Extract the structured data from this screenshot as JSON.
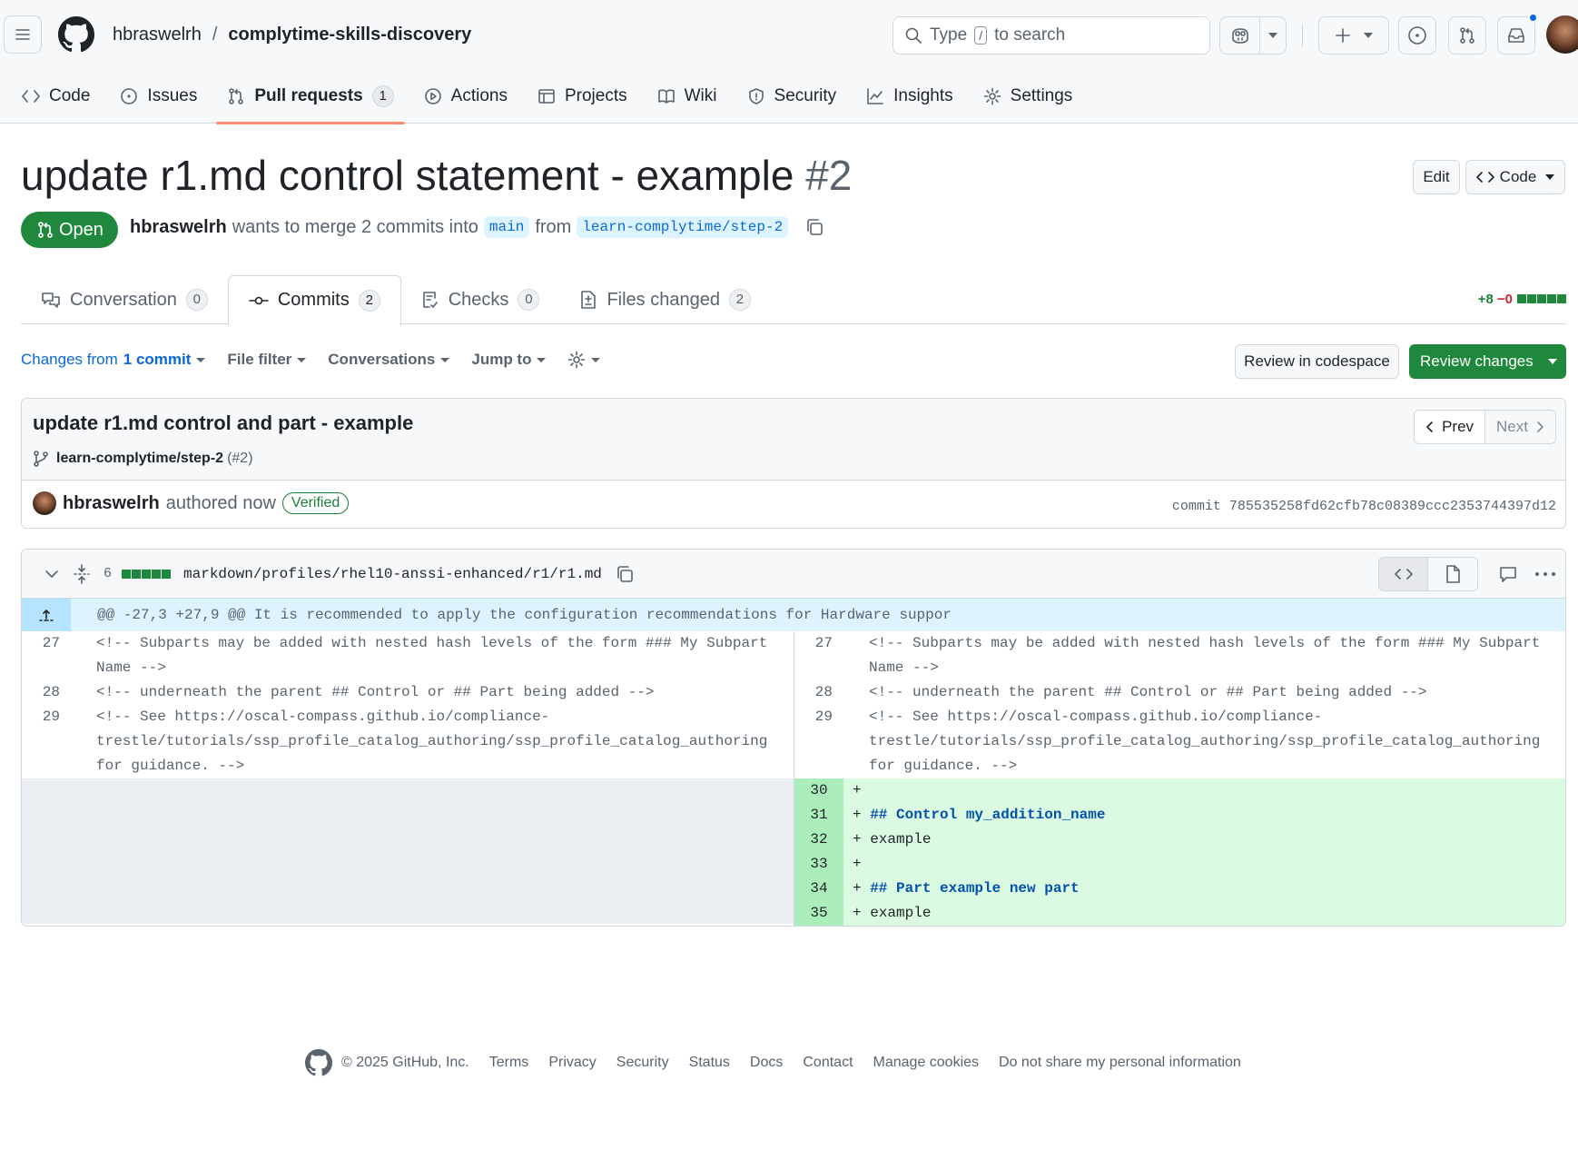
{
  "header": {
    "owner": "hbraswelrh",
    "separator": "/",
    "repo": "complytime-skills-discovery",
    "search_prefix": "Type",
    "search_key": "/",
    "search_suffix": "to search"
  },
  "repo_nav": [
    {
      "label": "Code",
      "icon": "code-icon"
    },
    {
      "label": "Issues",
      "icon": "issue-icon"
    },
    {
      "label": "Pull requests",
      "icon": "git-pull-request-icon",
      "count": "1",
      "selected": true
    },
    {
      "label": "Actions",
      "icon": "play-icon"
    },
    {
      "label": "Projects",
      "icon": "table-icon"
    },
    {
      "label": "Wiki",
      "icon": "book-icon"
    },
    {
      "label": "Security",
      "icon": "shield-icon"
    },
    {
      "label": "Insights",
      "icon": "graph-icon"
    },
    {
      "label": "Settings",
      "icon": "gear-icon"
    }
  ],
  "pr": {
    "title": "update r1.md control statement - example",
    "number": "#2",
    "edit_label": "Edit",
    "code_label": "Code",
    "state": "Open",
    "author": "hbraswelrh",
    "merge_text": "wants to merge 2 commits into",
    "base": "main",
    "from_text": "from",
    "head": "learn-complytime/step-2"
  },
  "pr_tabs": [
    {
      "label": "Conversation",
      "count": "0"
    },
    {
      "label": "Commits",
      "count": "2"
    },
    {
      "label": "Checks",
      "count": "0"
    },
    {
      "label": "Files changed",
      "count": "2"
    }
  ],
  "diffstat": {
    "additions": "+8",
    "deletions": "−0"
  },
  "toolbar": {
    "changes_from": "Changes from",
    "commit_count": "1 commit",
    "file_filter": "File filter",
    "conversations": "Conversations",
    "jump_to": "Jump to",
    "review_codespace": "Review in codespace",
    "review_changes": "Review changes"
  },
  "commit": {
    "title": "update r1.md control and part - example",
    "branch": "learn-complytime/step-2",
    "pr_ref": "(#2)",
    "prev": "Prev",
    "next": "Next",
    "author": "hbraswelrh",
    "authored": "authored now",
    "verified": "Verified",
    "sha": "commit 785535258fd62cfb78c08389ccc2353744397d12"
  },
  "file": {
    "changes": "6",
    "path": "markdown/profiles/rhel10-anssi-enhanced/r1/r1.md",
    "hunk": "@@ -27,3 +27,9 @@ It is recommended to apply the configuration recommendations for Hardware suppor"
  },
  "diff_lines": [
    {
      "n": "27",
      "text": "<!-- Subparts may be added with nested hash levels of the form ### My Subpart Name -->"
    },
    {
      "n": "28",
      "text": "<!-- underneath the parent ## Control or ## Part being added -->"
    },
    {
      "n": "29",
      "text": "<!-- See https://oscal-compass.github.io/compliance-trestle/tutorials/ssp_profile_catalog_authoring/ssp_profile_catalog_authoring for guidance. -->"
    }
  ],
  "added_lines": [
    {
      "n": "30",
      "text": ""
    },
    {
      "n": "31",
      "text": "## Control my_addition_name"
    },
    {
      "n": "32",
      "text": "example"
    },
    {
      "n": "33",
      "text": ""
    },
    {
      "n": "34",
      "text": "## Part example new part"
    },
    {
      "n": "35",
      "text": "example"
    }
  ],
  "footer": {
    "copyright": "© 2025 GitHub, Inc.",
    "links": [
      "Terms",
      "Privacy",
      "Security",
      "Status",
      "Docs",
      "Contact",
      "Manage cookies",
      "Do not share my personal information"
    ]
  },
  "colors": {
    "accent": "#1f883d",
    "link": "#0969da",
    "tab_underline": "#fd8c73"
  }
}
